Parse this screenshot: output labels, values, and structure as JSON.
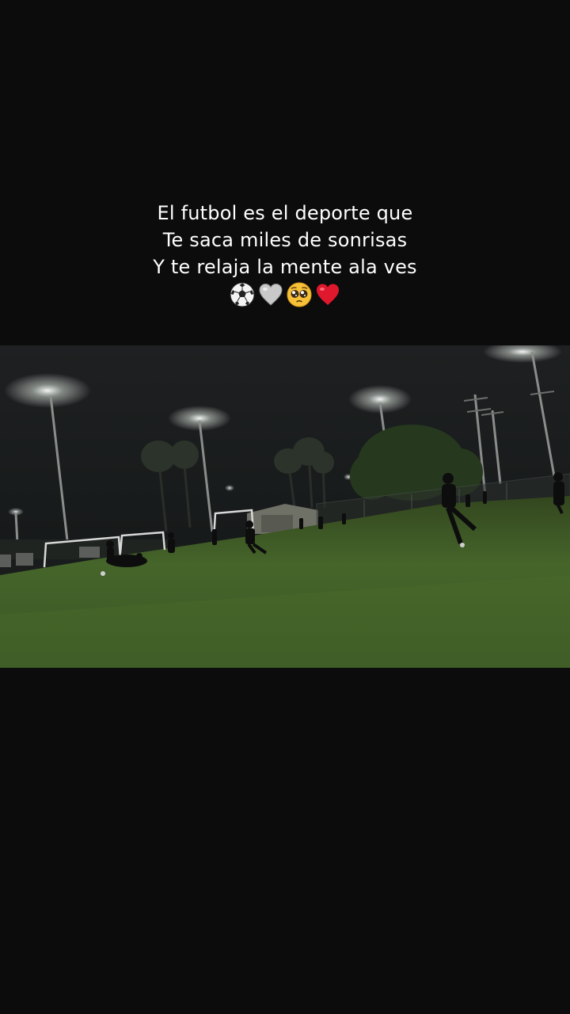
{
  "caption": {
    "lines": [
      "El futbol es el deporte que",
      "Te saca miles de sonrisas",
      "Y te relaja la mente ala ves"
    ],
    "emojis": [
      "soccer-ball-icon",
      "white-heart-icon",
      "pleading-face-icon",
      "red-heart-icon"
    ]
  },
  "colors": {
    "background": "#0c0c0c",
    "caption_text": "#ffffff",
    "grass": "#3d5a22",
    "night_sky": "#1a1c1d"
  }
}
